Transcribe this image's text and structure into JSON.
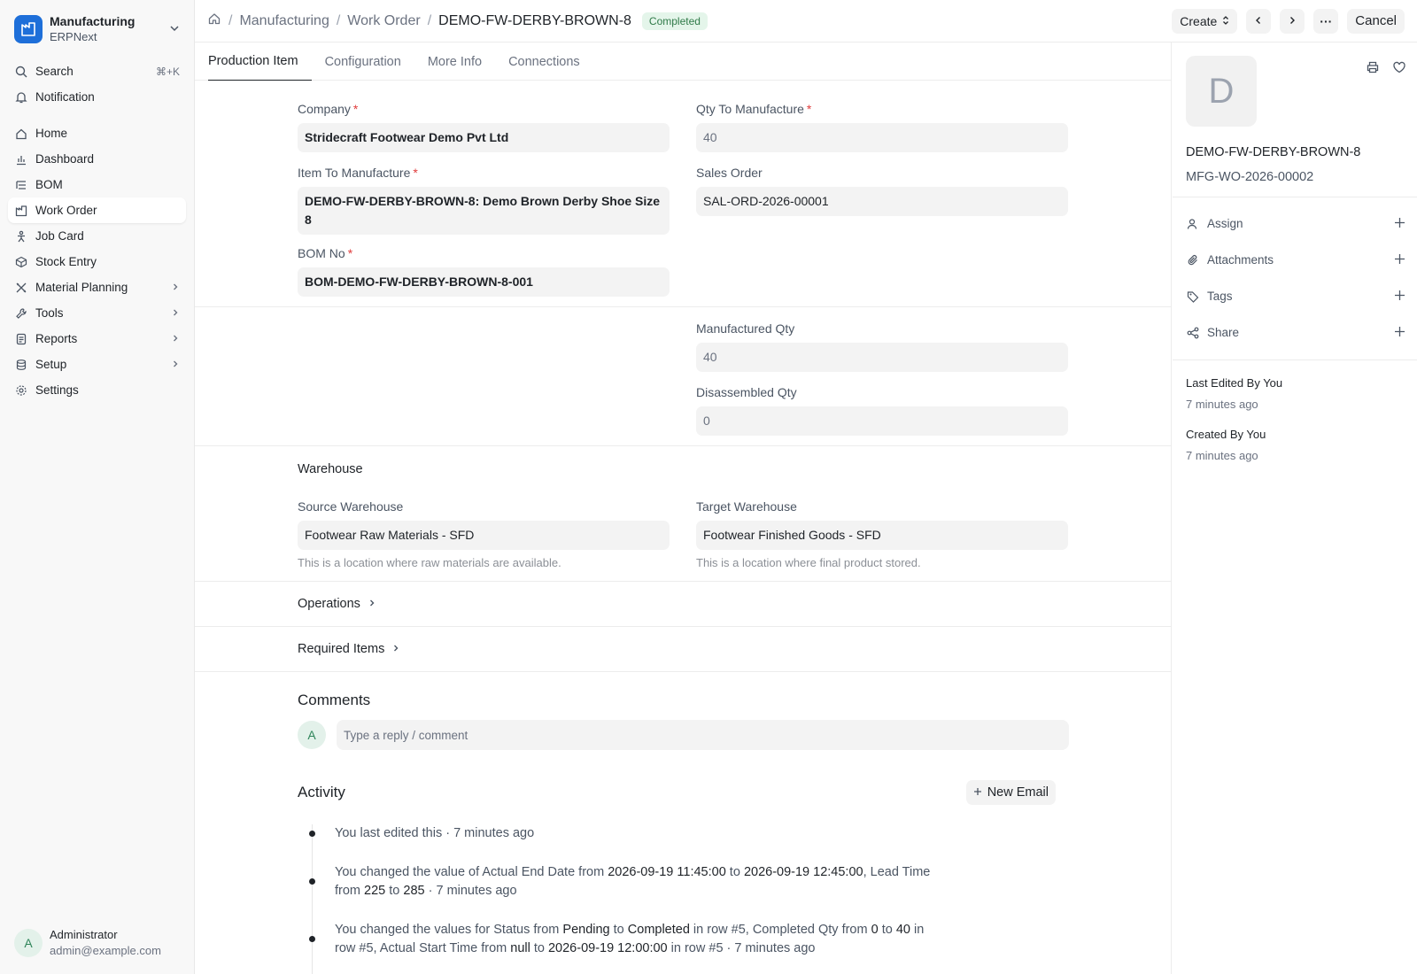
{
  "app": {
    "name": "Manufacturing",
    "sub": "ERPNext"
  },
  "sidebar": {
    "search_label": "Search",
    "search_shortcut": "⌘+K",
    "notification_label": "Notification",
    "items": [
      {
        "label": "Home",
        "icon": "home-icon"
      },
      {
        "label": "Dashboard",
        "icon": "chart-icon"
      },
      {
        "label": "BOM",
        "icon": "list-icon"
      },
      {
        "label": "Work Order",
        "icon": "factory-icon"
      },
      {
        "label": "Job Card",
        "icon": "person-icon"
      },
      {
        "label": "Stock Entry",
        "icon": "box-icon"
      },
      {
        "label": "Material Planning",
        "icon": "tools-icon"
      },
      {
        "label": "Tools",
        "icon": "wrench-icon"
      },
      {
        "label": "Reports",
        "icon": "report-icon"
      },
      {
        "label": "Setup",
        "icon": "database-icon"
      },
      {
        "label": "Settings",
        "icon": "gear-icon"
      }
    ],
    "user": {
      "initial": "A",
      "name": "Administrator",
      "email": "admin@example.com"
    }
  },
  "header": {
    "breadcrumbs": [
      "Manufacturing",
      "Work Order",
      "DEMO-FW-DERBY-BROWN-8"
    ],
    "status": "Completed",
    "create_label": "Create",
    "cancel_label": "Cancel",
    "more_label": "···"
  },
  "tabs": [
    "Production Item",
    "Configuration",
    "More Info",
    "Connections"
  ],
  "form": {
    "company_label": "Company",
    "company": "Stridecraft Footwear Demo Pvt Ltd",
    "qty_label": "Qty To Manufacture",
    "qty": "40",
    "item_label": "Item To Manufacture",
    "item": "DEMO-FW-DERBY-BROWN-8: Demo Brown Derby Shoe Size 8",
    "sales_order_label": "Sales Order",
    "sales_order": "SAL-ORD-2026-00001",
    "bom_label": "BOM No",
    "bom": "BOM-DEMO-FW-DERBY-BROWN-8-001",
    "manufactured_label": "Manufactured Qty",
    "manufactured": "40",
    "disassembled_label": "Disassembled Qty",
    "disassembled": "0",
    "required_mark": "*"
  },
  "warehouse": {
    "title": "Warehouse",
    "source_label": "Source Warehouse",
    "source": "Footwear Raw Materials - SFD",
    "source_hint": "This is a location where raw materials are available.",
    "target_label": "Target Warehouse",
    "target": "Footwear Finished Goods - SFD",
    "target_hint": "This is a location where final product stored."
  },
  "sections": {
    "operations": "Operations",
    "required_items": "Required Items"
  },
  "comments": {
    "title": "Comments",
    "avatar": "A",
    "placeholder": "Type a reply / comment"
  },
  "activity": {
    "title": "Activity",
    "new_email": "New Email",
    "items": {
      "i1": {
        "t1": "You last edited this · 7 minutes ago"
      },
      "i2": {
        "t1": "You changed the value of Actual End Date from ",
        "v1": "2026-09-19 11:45:00",
        "t2": " to ",
        "v2": "2026-09-19 12:45:00",
        "t3": ", Lead Time from ",
        "v3": "225",
        "t4": " to ",
        "v4": "285",
        "t5": " · 7 minutes ago"
      },
      "i3": {
        "t1": "You changed the values for Status from ",
        "v1": "Pending",
        "t2": " to ",
        "v2": "Completed",
        "t3": " in row #5, Completed Qty from ",
        "v3": "0",
        "t4": " to ",
        "v4": "40",
        "t5": " in row #5, Actual Start Time from ",
        "v5": "null",
        "t6": " to ",
        "v6": "2026-09-19 12:00:00",
        "t7": " in row #5 · 7 minutes ago"
      }
    }
  },
  "right_panel": {
    "avatar_letter": "D",
    "name": "DEMO-FW-DERBY-BROWN-8",
    "id": "MFG-WO-2026-00002",
    "actions": [
      "Assign",
      "Attachments",
      "Tags",
      "Share"
    ],
    "last_edited": "Last Edited By You",
    "last_edited_time": "7 minutes ago",
    "created": "Created By You",
    "created_time": "7 minutes ago"
  },
  "colors": {
    "brand": "#1e6fd9",
    "status_bg": "#e4f5ea",
    "status_text": "#2f7a48",
    "required": "#e03c3c"
  }
}
